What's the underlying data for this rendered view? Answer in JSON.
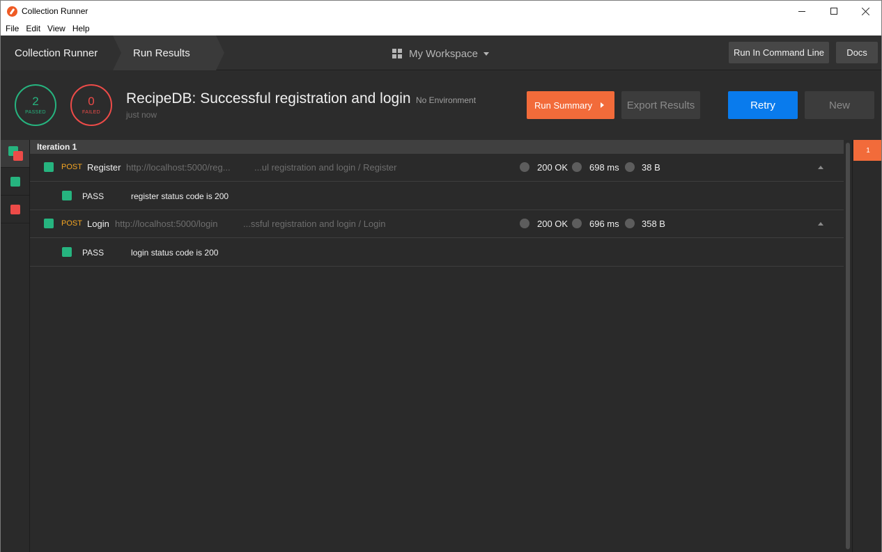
{
  "window": {
    "title": "Collection Runner"
  },
  "menu": [
    "File",
    "Edit",
    "View",
    "Help"
  ],
  "nav": {
    "crumb_runner": "Collection Runner",
    "crumb_results": "Run Results",
    "workspace": "My Workspace",
    "btn_cli": "Run In Command Line",
    "btn_docs": "Docs"
  },
  "summary": {
    "passed_count": "2",
    "passed_label": "PASSED",
    "failed_count": "0",
    "failed_label": "FAILED",
    "title": "RecipeDB: Successful registration and login",
    "environment": "No Environment",
    "time": "just now",
    "btn_run_summary": "Run Summary",
    "btn_export": "Export Results",
    "btn_retry": "Retry",
    "btn_new": "New"
  },
  "iteration": {
    "label": "Iteration 1",
    "chip": "1"
  },
  "requests": [
    {
      "method": "POST",
      "name": "Register",
      "url": "http://localhost:5000/reg...",
      "path": "...ul registration and login / Register",
      "status": "200 OK",
      "time": "698 ms",
      "size": "38 B",
      "test": {
        "result": "PASS",
        "name": "register status code is 200"
      }
    },
    {
      "method": "POST",
      "name": "Login",
      "url": "http://localhost:5000/login",
      "path": "...ssful registration and login / Login",
      "status": "200 OK",
      "time": "696 ms",
      "size": "358 B",
      "test": {
        "result": "PASS",
        "name": "login status code is 200"
      }
    }
  ],
  "colors": {
    "pass": "#26b47f",
    "fail": "#ed4b48",
    "accent": "#f26b3a",
    "primary": "#097bed",
    "method_post": "#f5a623"
  }
}
